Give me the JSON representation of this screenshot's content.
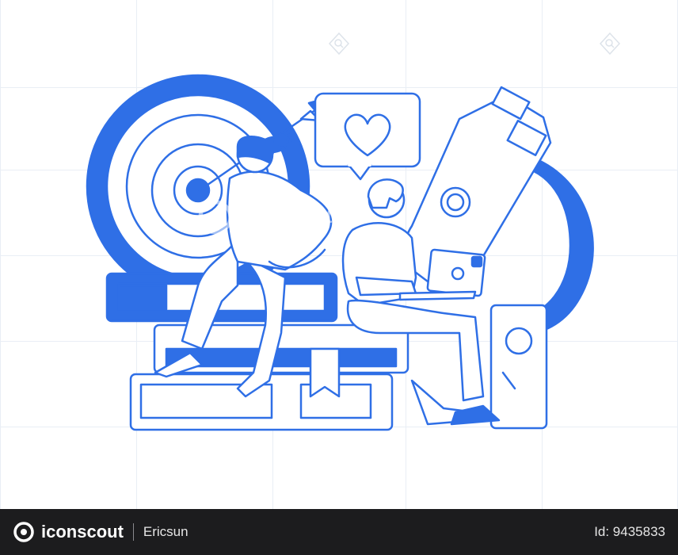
{
  "watermark": {
    "brand": "iconscout",
    "author": "Ericsun"
  },
  "footer": {
    "brand": "iconscout",
    "author": "Ericsun",
    "asset_id": "Id: 9435833"
  },
  "illustration": {
    "palette": {
      "primary": "#2f6fe6",
      "stroke": "#2f6fe6",
      "fill": "#ffffff",
      "grid": "#e9eef5",
      "footer_bg": "#1c1c1e"
    },
    "icons": [
      "target-icon",
      "arrow-icon",
      "heart-bubble-icon",
      "microscope-icon",
      "books-icon",
      "laptop-icon",
      "bookmark-icon"
    ]
  }
}
